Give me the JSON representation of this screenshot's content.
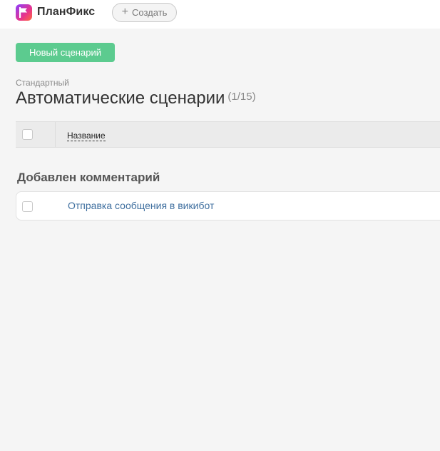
{
  "app": {
    "brand": "ПланФикс",
    "create_label": "Создать"
  },
  "toolbar": {
    "new_scenario_label": "Новый сценарий"
  },
  "page": {
    "subtitle": "Стандартный",
    "title": "Автоматические сценарии",
    "count": "(1/15)"
  },
  "table": {
    "columns": [
      "Название"
    ]
  },
  "groups": [
    {
      "title": "Добавлен комментарий",
      "rows": [
        {
          "name": "Отправка сообщения в викибот"
        }
      ]
    }
  ],
  "colors": {
    "primary": "#5ccb8f",
    "link": "#3f6f9f",
    "background": "#f5f5f5"
  },
  "icons": {
    "logo": "planfix-logo-icon",
    "create": "plus-icon"
  }
}
